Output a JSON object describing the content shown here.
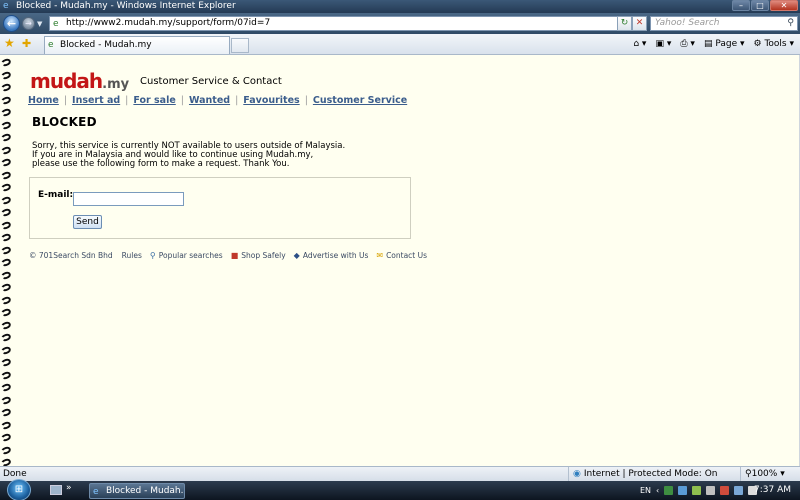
{
  "window": {
    "title": "Blocked - Mudah.my - Windows Internet Explorer",
    "url": "http://www2.mudah.my/support/form/07id=7",
    "search_placeholder": "Yahoo! Search"
  },
  "tab": {
    "label": "Blocked - Mudah.my"
  },
  "commands": {
    "page": "Page",
    "tools": "Tools"
  },
  "site": {
    "logo_brand": "mudah",
    "logo_suffix": ".my",
    "heading": "Customer Service & Contact",
    "nav": [
      "Home",
      "Insert ad",
      "For sale",
      "Wanted",
      "Favourites",
      "Customer Service"
    ]
  },
  "blocked": {
    "title": "BLOCKED",
    "message_lines": [
      "Sorry, this service is currently NOT available to users outside of Malaysia.",
      "If you are in Malaysia and would like to continue using Mudah.my,",
      "please use the following form to make a request. Thank You."
    ]
  },
  "form": {
    "email_label": "E-mail:",
    "email_value": "",
    "send_label": "Send"
  },
  "footer": {
    "copyright": "© 701Search Sdn Bhd",
    "links": [
      "Rules",
      "Popular searches",
      "Shop Safely",
      "Advertise with Us",
      "Contact Us"
    ]
  },
  "status": {
    "text": "Done",
    "zone": "Internet | Protected Mode: On",
    "zoom": "100%"
  },
  "taskbar": {
    "window_label": "Blocked - Mudah.m...",
    "lang": "EN",
    "time": "7:37 AM"
  }
}
